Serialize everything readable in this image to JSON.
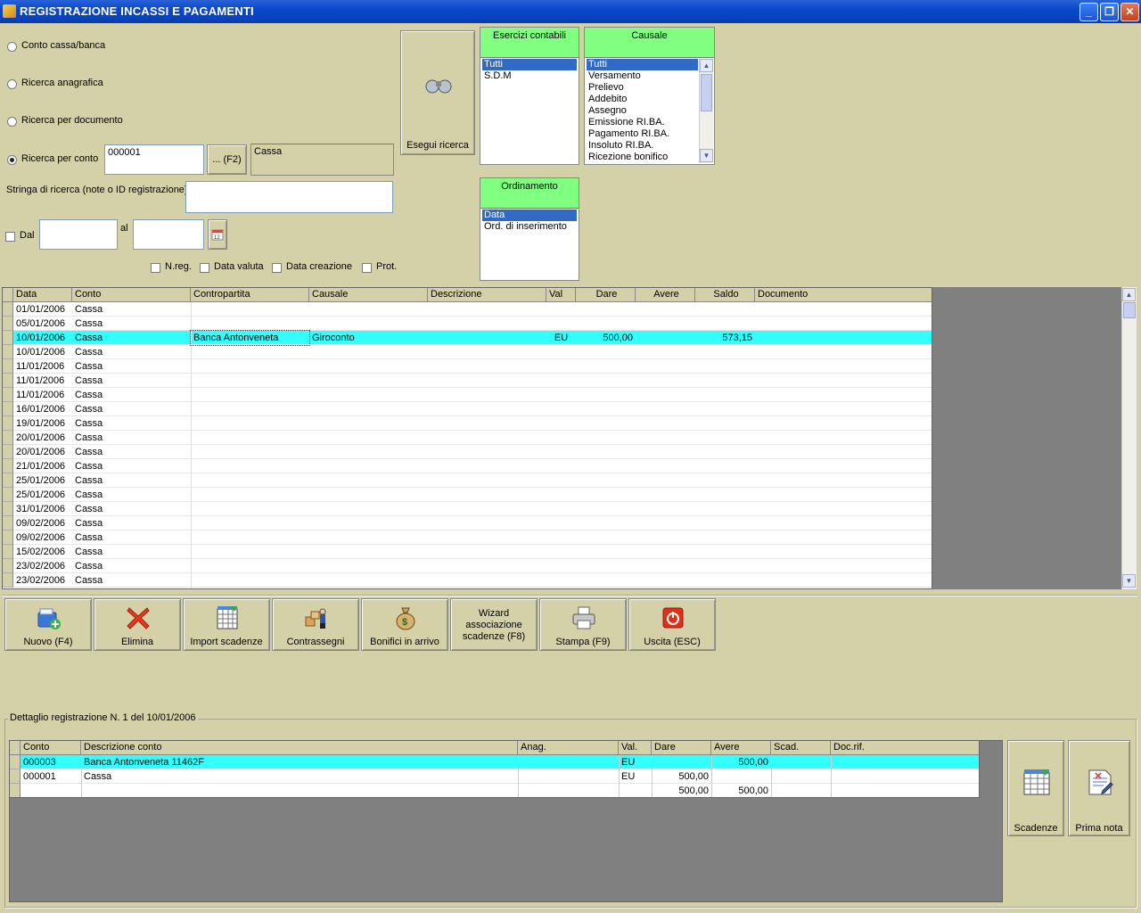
{
  "window": {
    "title": "REGISTRAZIONE INCASSI E PAGAMENTI",
    "minimize": "_",
    "restore": "❐",
    "close": "✕"
  },
  "search": {
    "opt_conto_cassa": "Conto cassa/banca",
    "opt_anagrafica": "Ricerca anagrafica",
    "opt_documento": "Ricerca per documento",
    "opt_conto": "Ricerca per conto",
    "conto_code": "000001",
    "f2_button": "... (F2)",
    "conto_name": "Cassa",
    "string_label": "Stringa di ricerca (note o ID registrazione)",
    "dal_label": "Dal",
    "al_label": "al",
    "chk_nreg": "N.reg.",
    "chk_data_valuta": "Data valuta",
    "chk_data_creazione": "Data creazione",
    "chk_prot": "Prot.",
    "execute_button": "Esegui ricerca"
  },
  "esercizi": {
    "header": "Esercizi contabili",
    "items": [
      "Tutti",
      "S.D.M"
    ]
  },
  "causale": {
    "header": "Causale",
    "items": [
      "Tutti",
      "Versamento",
      "Prelievo",
      "Addebito",
      "Assegno",
      "Emissione RI.BA.",
      "Pagamento RI.BA.",
      "Insoluto RI.BA.",
      "Ricezione bonifico"
    ]
  },
  "ordinamento": {
    "header": "Ordinamento",
    "items": [
      "Data",
      "Ord. di inserimento"
    ]
  },
  "main_grid": {
    "columns": [
      "Data",
      "Conto",
      "Contropartita",
      "Causale",
      "Descrizione",
      "Val",
      "Dare",
      "Avere",
      "Saldo",
      "Documento"
    ],
    "highlight": {
      "contropartita": "Banca Antonveneta",
      "causale": "Giroconto",
      "val": "EU",
      "dare": "500,00",
      "saldo": "573,15"
    },
    "rows": [
      {
        "data": "01/01/2006",
        "conto": "Cassa"
      },
      {
        "data": "05/01/2006",
        "conto": "Cassa"
      },
      {
        "data": "10/01/2006",
        "conto": "Cassa"
      },
      {
        "data": "10/01/2006",
        "conto": "Cassa"
      },
      {
        "data": "11/01/2006",
        "conto": "Cassa"
      },
      {
        "data": "11/01/2006",
        "conto": "Cassa"
      },
      {
        "data": "11/01/2006",
        "conto": "Cassa"
      },
      {
        "data": "16/01/2006",
        "conto": "Cassa"
      },
      {
        "data": "19/01/2006",
        "conto": "Cassa"
      },
      {
        "data": "20/01/2006",
        "conto": "Cassa"
      },
      {
        "data": "20/01/2006",
        "conto": "Cassa"
      },
      {
        "data": "21/01/2006",
        "conto": "Cassa"
      },
      {
        "data": "25/01/2006",
        "conto": "Cassa"
      },
      {
        "data": "25/01/2006",
        "conto": "Cassa"
      },
      {
        "data": "31/01/2006",
        "conto": "Cassa"
      },
      {
        "data": "09/02/2006",
        "conto": "Cassa"
      },
      {
        "data": "09/02/2006",
        "conto": "Cassa"
      },
      {
        "data": "15/02/2006",
        "conto": "Cassa"
      },
      {
        "data": "23/02/2006",
        "conto": "Cassa"
      },
      {
        "data": "23/02/2006",
        "conto": "Cassa"
      }
    ]
  },
  "toolbar": {
    "nuovo": "Nuovo (F4)",
    "elimina": "Elimina",
    "import": "Import scadenze",
    "contrassegni": "Contrassegni",
    "bonifici": "Bonifici in arrivo",
    "wizard": "Wizard associazione scadenze (F8)",
    "stampa": "Stampa (F9)",
    "uscita": "Uscita (ESC)"
  },
  "detail": {
    "title": "Dettaglio registrazione N. 1 del 10/01/2006",
    "columns": [
      "Conto",
      "Descrizione conto",
      "Anag.",
      "Val.",
      "Dare",
      "Avere",
      "Scad.",
      "Doc.rif."
    ],
    "rows": [
      {
        "conto": "000003",
        "descr": "Banca Antonveneta 11462F",
        "val": "EU",
        "dare": "",
        "avere": "500,00"
      },
      {
        "conto": "000001",
        "descr": "Cassa",
        "val": "EU",
        "dare": "500,00",
        "avere": ""
      }
    ],
    "totals": {
      "dare": "500,00",
      "avere": "500,00"
    },
    "scadenze_button": "Scadenze",
    "prima_nota_button": "Prima nota"
  }
}
